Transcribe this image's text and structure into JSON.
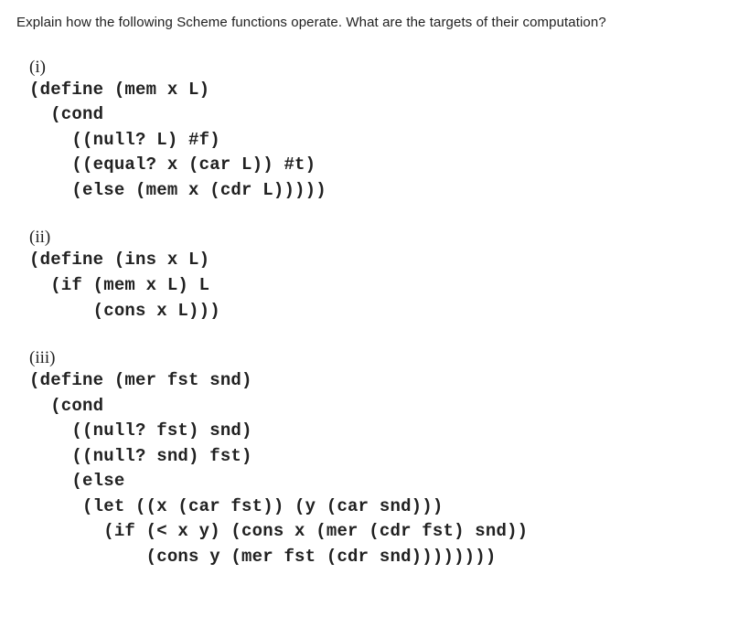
{
  "question": "Explain how the following Scheme functions operate. What are the targets of their computation?",
  "parts": [
    {
      "label": "(i)",
      "code": "(define (mem x L)\n  (cond\n    ((null? L) #f)\n    ((equal? x (car L)) #t)\n    (else (mem x (cdr L)))))"
    },
    {
      "label": "(ii)",
      "code": "(define (ins x L)\n  (if (mem x L) L\n      (cons x L)))"
    },
    {
      "label": "(iii)",
      "code": "(define (mer fst snd)\n  (cond\n    ((null? fst) snd)\n    ((null? snd) fst)\n    (else\n     (let ((x (car fst)) (y (car snd)))\n       (if (< x y) (cons x (mer (cdr fst) snd))\n           (cons y (mer fst (cdr snd))))))))"
    }
  ]
}
